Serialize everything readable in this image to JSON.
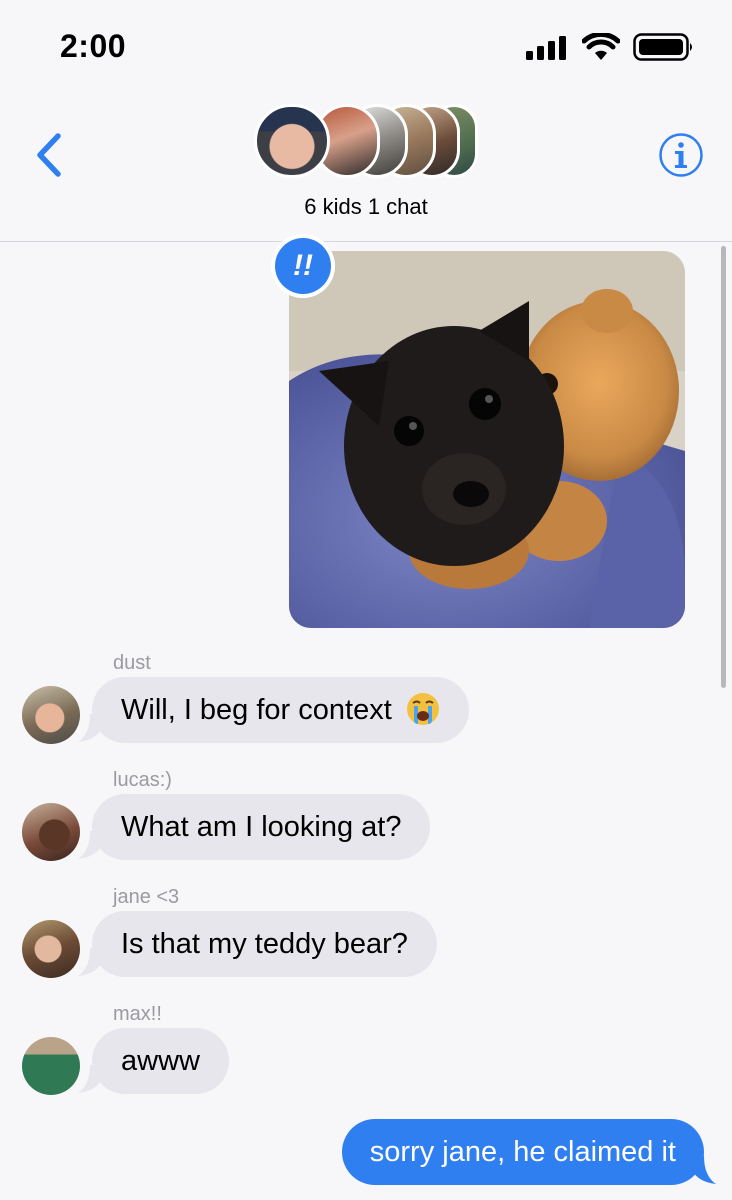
{
  "status_bar": {
    "time": "2:00"
  },
  "header": {
    "chat_title": "6 kids 1 chat"
  },
  "photo_message": {
    "tapback": "!!"
  },
  "messages": [
    {
      "sender": "dust",
      "text": "Will, I beg for context",
      "emoji": "loudly-crying-face"
    },
    {
      "sender": "lucas:)",
      "text": "What am I looking at?"
    },
    {
      "sender": "jane <3",
      "text": "Is that my teddy bear?"
    },
    {
      "sender": "max!!",
      "text": "awww"
    }
  ],
  "outgoing": {
    "text": "sorry jane, he claimed it"
  },
  "colors": {
    "accent": "#2f7ff1",
    "incoming_bubble": "#e7e6ec",
    "background": "#f7f7f9"
  }
}
